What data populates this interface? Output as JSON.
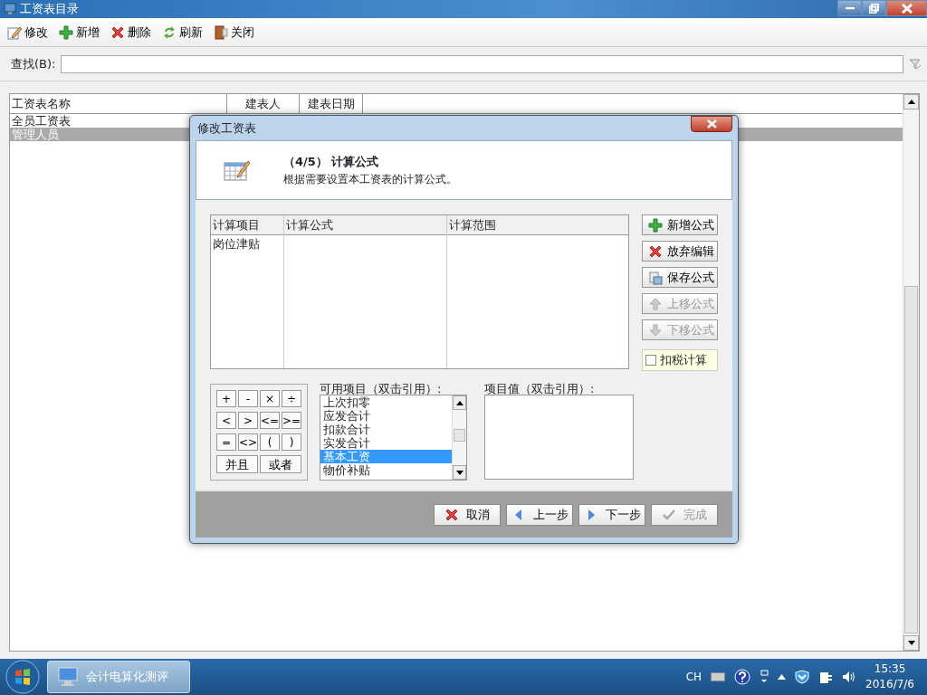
{
  "window": {
    "title": "工资表目录"
  },
  "toolbar": [
    {
      "label": "修改",
      "kind": "edit"
    },
    {
      "label": "新增",
      "kind": "add"
    },
    {
      "label": "删除",
      "kind": "delete"
    },
    {
      "label": "刷新",
      "kind": "refresh"
    },
    {
      "label": "关闭",
      "kind": "door"
    }
  ],
  "search": {
    "label": "查找(B):"
  },
  "table": {
    "columns": [
      "工资表名称",
      "建表人",
      "建表日期"
    ],
    "rows": [
      {
        "name": "全员工资表",
        "selected": false
      },
      {
        "name": "管理人员",
        "selected": true
      }
    ]
  },
  "dialog": {
    "title": "修改工资表",
    "step": "（4/5） 计算公式",
    "description": "根据需要设置本工资表的计算公式。",
    "formula_table": {
      "columns": [
        "计算项目",
        "计算公式",
        "计算范围"
      ],
      "rows": [
        {
          "item": "岗位津贴"
        }
      ]
    },
    "side_buttons": [
      {
        "label": "新增公式",
        "kind": "add",
        "disabled": false
      },
      {
        "label": "放弃编辑",
        "kind": "delete",
        "disabled": false
      },
      {
        "label": "保存公式",
        "kind": "save",
        "disabled": false
      },
      {
        "label": "上移公式",
        "kind": "up",
        "disabled": true
      },
      {
        "label": "下移公式",
        "kind": "down",
        "disabled": true
      }
    ],
    "tax_checkbox": {
      "label": "扣税计算",
      "checked": false
    },
    "operators": [
      "+",
      "-",
      "×",
      "÷",
      "<",
      ">",
      "<=",
      ">=",
      "=",
      "<>",
      "(",
      ")",
      "并且",
      "或者"
    ],
    "available_items": {
      "label": "可用项目（双击引用）:",
      "items": [
        {
          "label": "上次扣零",
          "selected": false
        },
        {
          "label": "应发合计",
          "selected": false
        },
        {
          "label": "扣款合计",
          "selected": false
        },
        {
          "label": "实发合计",
          "selected": false
        },
        {
          "label": "基本工资",
          "selected": true
        },
        {
          "label": "物价补贴",
          "selected": false
        }
      ]
    },
    "item_values": {
      "label": "项目值（双击引用）:"
    },
    "footer_buttons": [
      {
        "label": "取消",
        "kind": "cancel",
        "disabled": false
      },
      {
        "label": "上一步",
        "kind": "back",
        "disabled": false
      },
      {
        "label": "下一步",
        "kind": "next",
        "disabled": false
      },
      {
        "label": "完成",
        "kind": "finish",
        "disabled": true
      }
    ]
  },
  "taskbar": {
    "app": "会计电算化测评",
    "language": "CH",
    "time": "15:35",
    "date": "2016/7/6"
  }
}
